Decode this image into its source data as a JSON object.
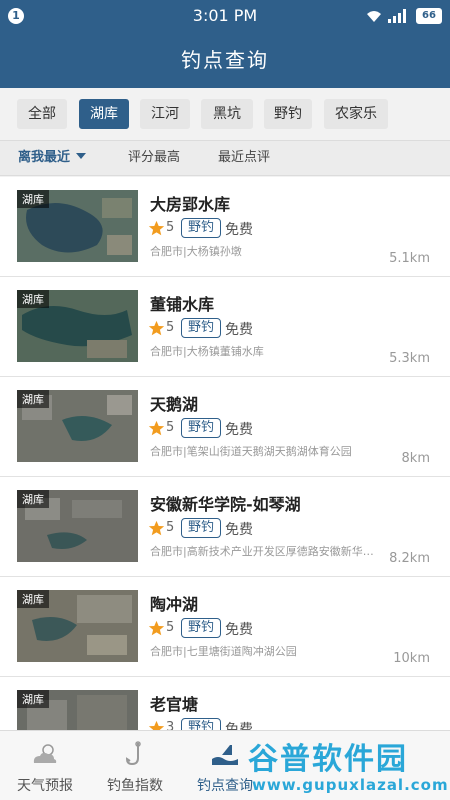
{
  "status_bar": {
    "notification_count": "1",
    "time": "3:01 PM",
    "battery": "66"
  },
  "header": {
    "title": "钓点查询"
  },
  "filters": [
    {
      "label": "全部",
      "active": false
    },
    {
      "label": "湖库",
      "active": true
    },
    {
      "label": "江河",
      "active": false
    },
    {
      "label": "黑坑",
      "active": false
    },
    {
      "label": "野钓",
      "active": false
    },
    {
      "label": "农家乐",
      "active": false
    }
  ],
  "sort": [
    {
      "label": "离我最近",
      "active": true
    },
    {
      "label": "评分最高",
      "active": false
    },
    {
      "label": "最近点评",
      "active": false
    }
  ],
  "spots": [
    {
      "tag": "湖库",
      "name": "大房郢水库",
      "rating": "5",
      "type": "野钓",
      "fee": "免费",
      "address": "合肥市|大杨镇孙墩",
      "distance": "5.1km"
    },
    {
      "tag": "湖库",
      "name": "董铺水库",
      "rating": "5",
      "type": "野钓",
      "fee": "免费",
      "address": "合肥市|大杨镇董铺水库",
      "distance": "5.3km"
    },
    {
      "tag": "湖库",
      "name": "天鹅湖",
      "rating": "5",
      "type": "野钓",
      "fee": "免费",
      "address": "合肥市|笔架山街道天鹅湖天鹅湖体育公园",
      "distance": "8km"
    },
    {
      "tag": "湖库",
      "name": "安徽新华学院-如琴湖",
      "rating": "5",
      "type": "野钓",
      "fee": "免费",
      "address": "合肥市|高新技术产业开发区厚德路安徽新华…",
      "distance": "8.2km"
    },
    {
      "tag": "湖库",
      "name": "陶冲湖",
      "rating": "5",
      "type": "野钓",
      "fee": "免费",
      "address": "合肥市|七里塘街道陶冲湖公园",
      "distance": "10km"
    },
    {
      "tag": "湖库",
      "name": "老官塘",
      "rating": "3",
      "type": "野钓",
      "fee": "免费",
      "address": "",
      "distance": ""
    }
  ],
  "tabs": [
    {
      "label": "天气预报",
      "icon": "weather-icon",
      "active": false
    },
    {
      "label": "钓鱼指数",
      "icon": "fishing-hook-icon",
      "active": false
    },
    {
      "label": "钓点查询",
      "icon": "spot-icon",
      "active": true
    }
  ],
  "watermark": {
    "title": "谷普软件园",
    "url": "www.gupuxlazal.com"
  },
  "colors": {
    "primary": "#2f5f8a",
    "star": "#f29c1f",
    "watermark": "#2aa7d8"
  }
}
